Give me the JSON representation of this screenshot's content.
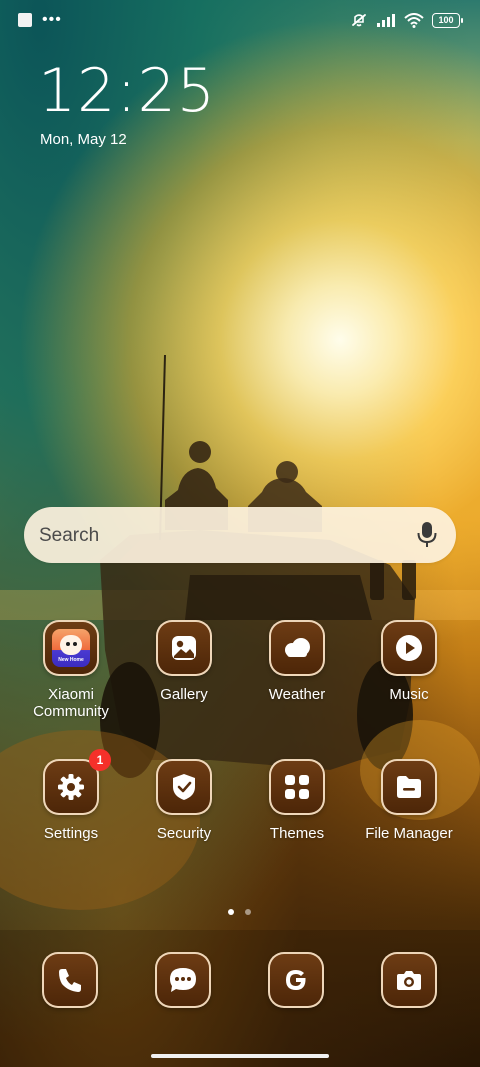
{
  "status_bar": {
    "left_icons": [
      "screenshot-indicator",
      "more-notifications"
    ],
    "right_icons": [
      "vibrate-off",
      "cellular-signal",
      "wifi"
    ],
    "battery": "100"
  },
  "lockscreen": {
    "time": "12:25",
    "date": "Mon, May 12"
  },
  "search": {
    "placeholder": "Search"
  },
  "apps": {
    "row1": [
      {
        "label": "Xiaomi\nCommunity",
        "icon": "xiaomi-community-icon"
      },
      {
        "label": "Gallery",
        "icon": "gallery-icon"
      },
      {
        "label": "Weather",
        "icon": "weather-icon"
      },
      {
        "label": "Music",
        "icon": "music-icon"
      }
    ],
    "row2": [
      {
        "label": "Settings",
        "icon": "gear-icon",
        "badge": "1"
      },
      {
        "label": "Security",
        "icon": "shield-icon"
      },
      {
        "label": "Themes",
        "icon": "themes-icon"
      },
      {
        "label": "File Manager",
        "icon": "folder-icon"
      }
    ]
  },
  "xiaomi_community_tag": "New Home",
  "dock": [
    {
      "icon": "phone-icon"
    },
    {
      "icon": "messages-icon"
    },
    {
      "icon": "google-icon"
    },
    {
      "icon": "camera-icon"
    }
  ],
  "pagination": {
    "current_page": 1,
    "page_count": 2
  },
  "colors": {
    "app_icon_bg": "#5d300d",
    "badge": "#f5302a"
  }
}
